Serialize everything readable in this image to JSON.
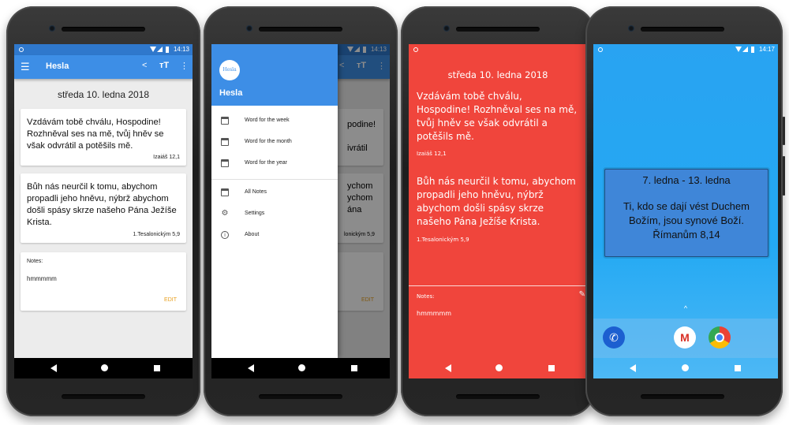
{
  "status": {
    "time1": "14:13",
    "time2": "14:13",
    "time3": "",
    "time4": "14:17"
  },
  "app": {
    "title": "Hesla",
    "date": "středa 10. ledna 2018"
  },
  "verses": [
    {
      "text": "Vzdávám tobě chválu, Hospodine! Rozhněval ses na mě, tvůj hněv se však odvrátil a potěšils mě.",
      "ref": "Izaiáš 12,1"
    },
    {
      "text": "Bůh nás neurčil k tomu, abychom propadli jeho hněvu, nýbrž abychom došli spásy skrze našeho Pána Ježíše Krista.",
      "ref": "1.Tesalonickým 5,9"
    }
  ],
  "notes": {
    "label": "Notes:",
    "text": "hmmmmm",
    "edit": "EDIT"
  },
  "drawer": {
    "logo": "Hesla",
    "title": "Hesla",
    "items": [
      "Word for the week",
      "Word for the month",
      "Word for the year",
      "All Notes",
      "Settings",
      "About"
    ],
    "partial": {
      "v1a": "podine!",
      "v1b": "ivrátil",
      "v1c": "",
      "v1d": "Izaiáš 12,1",
      "v2a": "ychom",
      "v2b": "ychom",
      "v2c": "ána",
      "v2d": "lonickým 5,9",
      "edit": "EDIT"
    }
  },
  "red": {
    "date": "středa 10. ledna 2018",
    "v1": "Vzdávám tobě chválu, Hospodine! Rozhněval ses na mě, tvůj hněv se však odvrátil a potěšils mě.",
    "r1": "Izaiáš 12,1",
    "v2": "Bůh nás neurčil k tomu, abychom propadli jeho hněvu, nýbrž abychom došli spásy skrze našeho Pána Ježíše Krista.",
    "r2": "1.Tesalonickým 5,9",
    "notes_label": "Notes:",
    "notes_text": "hmmmmm"
  },
  "widget": {
    "range": "7. ledna - 13. ledna",
    "text": "Ti, kdo se dají vést Duchem Božím, jsou synové Boží. Římanům 8,14"
  },
  "colors": {
    "primary": "#3d8ee6",
    "accent": "#e8a020",
    "red": "#f0453c",
    "sky": "#2aa4f0"
  }
}
